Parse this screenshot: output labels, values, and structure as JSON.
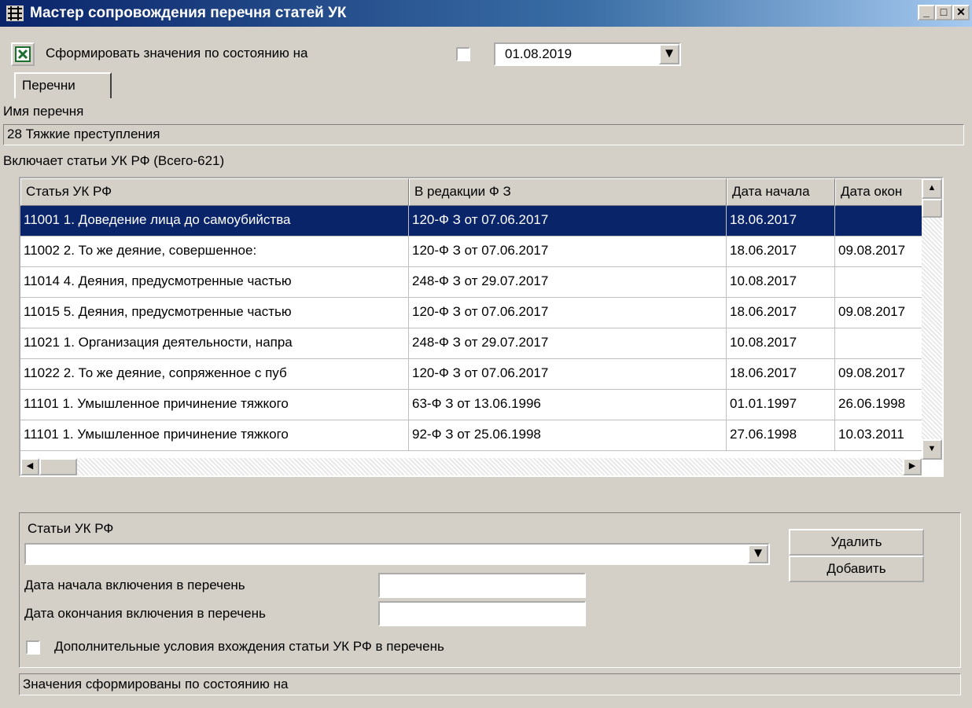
{
  "window": {
    "title": "Мастер сопровождения перечня статей УК",
    "minimize": "_",
    "maximize": "□",
    "close": "✕"
  },
  "toolbar": {
    "excel_icon": "excel-icon",
    "form_label": "Сформировать значения по состоянию на",
    "form_checked": false,
    "date_value": "01.08.2019"
  },
  "tabs": [
    {
      "label": "Перечни",
      "active": true
    }
  ],
  "list_name": {
    "label": "Имя перечня",
    "value": "28 Тяжкие преступления"
  },
  "articles": {
    "label": "Включает статьи УК РФ (Всего-621)",
    "columns": [
      "Статья УК РФ",
      "В редакции Ф З",
      "Дата начала",
      "Дата окон"
    ],
    "rows": [
      [
        "11001 1. Доведение лица до самоубийства",
        "120-Ф З от 07.06.2017",
        "18.06.2017",
        ""
      ],
      [
        "11002 2. То же деяние, совершенное:",
        "120-Ф З от 07.06.2017",
        "18.06.2017",
        "09.08.2017"
      ],
      [
        "11014 4. Деяния, предусмотренные частью",
        "248-Ф З от 29.07.2017",
        "10.08.2017",
        ""
      ],
      [
        "11015 5. Деяния, предусмотренные частью",
        "120-Ф З от 07.06.2017",
        "18.06.2017",
        "09.08.2017"
      ],
      [
        "11021 1. Организация деятельности, напра",
        "248-Ф З от 29.07.2017",
        "10.08.2017",
        ""
      ],
      [
        "11022 2. То же деяние, сопряженное с пуб",
        "120-Ф З от 07.06.2017",
        "18.06.2017",
        "09.08.2017"
      ],
      [
        "11101 1. Умышленное причинение тяжкого",
        "63-Ф З от 13.06.1996",
        "01.01.1997",
        "26.06.1998"
      ],
      [
        "11101 1. Умышленное причинение тяжкого",
        "92-Ф З от 25.06.1998",
        "27.06.1998",
        "10.03.2011"
      ]
    ],
    "selected_row": 0
  },
  "editor": {
    "articles_label": "Статьи УК РФ",
    "articles_value": "",
    "start_label": "Дата начала включения в перечень",
    "start_value": "",
    "end_label": "Дата окончания включения в перечень",
    "end_value": "",
    "extra_label": "Дополнительные условия вхождения статьи УК РФ в перечень",
    "extra_checked": false,
    "delete_label": "Удалить",
    "add_label": "Добавить"
  },
  "status": {
    "text": "Значения сформированы по состоянию на"
  },
  "colors": {
    "selection": "#0a246a",
    "window_face": "#d4d0c8",
    "title_start": "#0a246a",
    "title_end": "#a6caf0"
  }
}
